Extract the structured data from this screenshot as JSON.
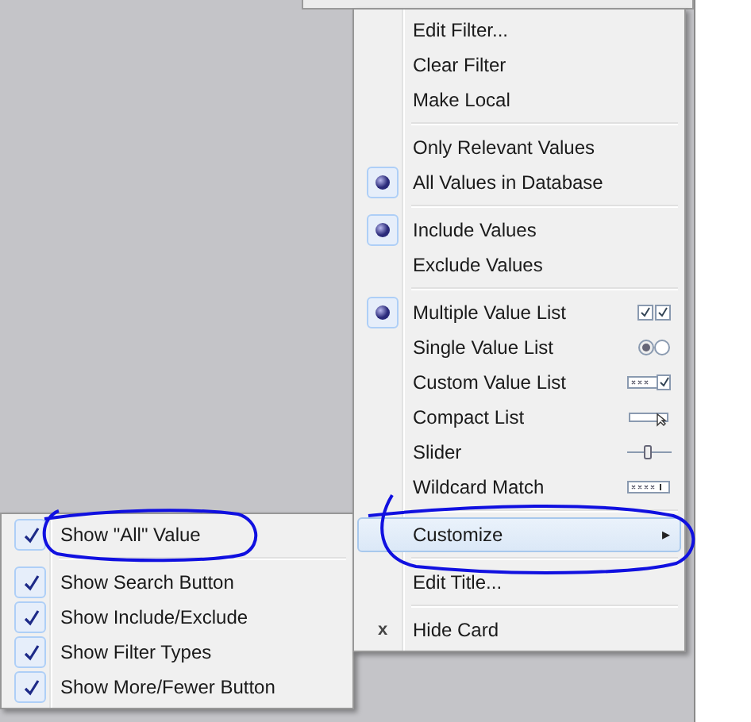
{
  "menu": {
    "groups": [
      [
        {
          "kind": "command",
          "label": "Edit Filter..."
        },
        {
          "kind": "command",
          "label": "Clear Filter"
        },
        {
          "kind": "command",
          "label": "Make Local"
        }
      ],
      [
        {
          "kind": "choice",
          "label": "Only Relevant Values",
          "selected": false
        },
        {
          "kind": "choice",
          "label": "All Values in Database",
          "selected": true
        }
      ],
      [
        {
          "kind": "choice",
          "label": "Include Values",
          "selected": true
        },
        {
          "kind": "choice",
          "label": "Exclude Values",
          "selected": false
        }
      ],
      [
        {
          "kind": "choice",
          "label": "Multiple Value List",
          "selected": true,
          "preview": {
            "kind": "checkboxes"
          }
        },
        {
          "kind": "choice",
          "label": "Single Value List",
          "selected": false,
          "preview": {
            "kind": "radios"
          }
        },
        {
          "kind": "choice",
          "label": "Custom Value List",
          "selected": false,
          "preview": {
            "kind": "custom"
          }
        },
        {
          "kind": "choice",
          "label": "Compact List",
          "selected": false,
          "preview": {
            "kind": "compact"
          }
        },
        {
          "kind": "choice",
          "label": "Slider",
          "selected": false,
          "preview": {
            "kind": "slider"
          }
        },
        {
          "kind": "choice",
          "label": "Wildcard Match",
          "selected": false,
          "preview": {
            "kind": "wildcard"
          }
        }
      ],
      [
        {
          "kind": "submenu",
          "label": "Customize",
          "highlighted": true,
          "arrow": "▸"
        }
      ],
      [
        {
          "kind": "command",
          "label": "Edit Title..."
        }
      ],
      [
        {
          "kind": "command",
          "label": "Hide Card",
          "glyph": "x"
        }
      ]
    ]
  },
  "submenu": {
    "groups": [
      [
        {
          "kind": "check",
          "label": "Show \"All\" Value",
          "checked": true
        }
      ],
      [
        {
          "kind": "check",
          "label": "Show Search Button",
          "checked": true
        },
        {
          "kind": "check",
          "label": "Show Include/Exclude",
          "checked": true
        },
        {
          "kind": "check",
          "label": "Show Filter Types",
          "checked": true
        },
        {
          "kind": "check",
          "label": "Show More/Fewer Button",
          "checked": true
        }
      ]
    ]
  }
}
